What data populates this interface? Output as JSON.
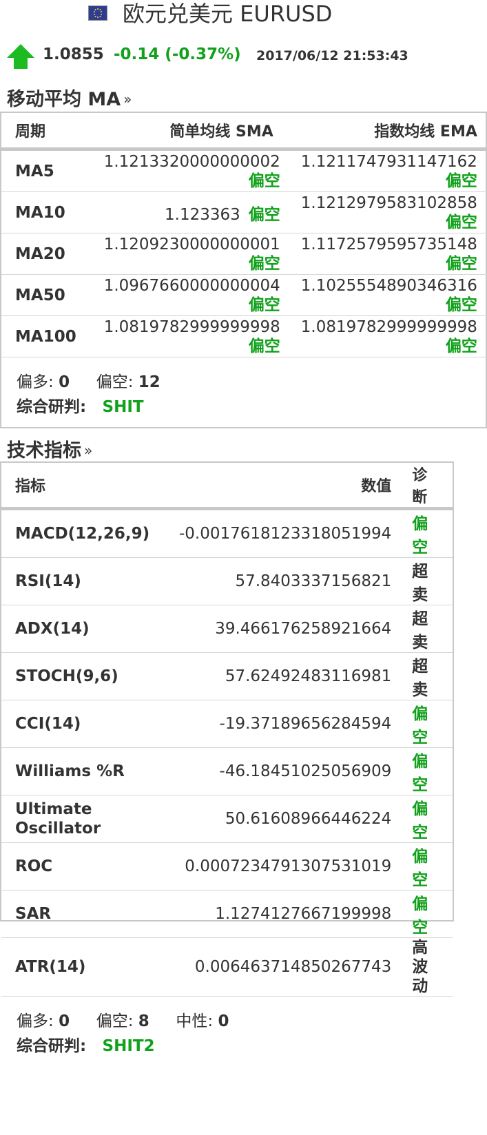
{
  "header": {
    "title": "欧元兑美元 EURUSD",
    "flag_icon": "eu-flag-icon",
    "trend_icon": "up-arrow-icon",
    "price": "1.0855",
    "change": "-0.14 (-0.37%)",
    "timestamp": "2017/06/12 21:53:43"
  },
  "colors": {
    "positive": "#11a11b",
    "text": "#333333",
    "border": "#c8c8c8"
  },
  "ma_section": {
    "title": "移动平均 MA",
    "link_icon": "double-chevron-right-icon",
    "columns": [
      "周期",
      "简单均线 SMA",
      "指数均线 EMA"
    ],
    "rows": [
      {
        "period": "MA5",
        "sma": "1.1213320000000002",
        "sma_signal": "偏空",
        "ema": "1.1211747931147162",
        "ema_signal": "偏空"
      },
      {
        "period": "MA10",
        "sma": "1.123363",
        "sma_signal": "偏空",
        "ema": "1.1212979583102858",
        "ema_signal": "偏空"
      },
      {
        "period": "MA20",
        "sma": "1.1209230000000001",
        "sma_signal": "偏空",
        "ema": "1.1172579595735148",
        "ema_signal": "偏空"
      },
      {
        "period": "MA50",
        "sma": "1.0967660000000004",
        "sma_signal": "偏空",
        "ema": "1.1025554890346316",
        "ema_signal": "偏空"
      },
      {
        "period": "MA100",
        "sma": "1.0819782999999998",
        "sma_signal": "偏空",
        "ema": "1.0819782999999998",
        "ema_signal": "偏空"
      }
    ],
    "summary": {
      "bull_label": "偏多:",
      "bull_count": "0",
      "bear_label": "偏空:",
      "bear_count": "12",
      "verdict_label": "综合研判:",
      "verdict": "SHIT"
    }
  },
  "indicator_section": {
    "title": "技术指标",
    "link_icon": "double-chevron-right-icon",
    "columns": [
      "指标",
      "数值",
      "诊断"
    ],
    "rows": [
      {
        "name": "MACD(12,26,9)",
        "value": "-0.0017618123318051994",
        "diag": "偏空",
        "diag_color": "#11a11b"
      },
      {
        "name": "RSI(14)",
        "value": "57.8403337156821",
        "diag": "超卖",
        "diag_color": "#333333"
      },
      {
        "name": "ADX(14)",
        "value": "39.466176258921664",
        "diag": "超卖",
        "diag_color": "#333333"
      },
      {
        "name": "STOCH(9,6)",
        "value": "57.62492483116981",
        "diag": "超卖",
        "diag_color": "#333333"
      },
      {
        "name": "CCI(14)",
        "value": "-19.37189656284594",
        "diag": "偏空",
        "diag_color": "#11a11b"
      },
      {
        "name": "Williams %R",
        "value": "-46.18451025056909",
        "diag": "偏空",
        "diag_color": "#11a11b"
      },
      {
        "name": "Ultimate Oscillator",
        "value": "50.61608966446224",
        "diag": "偏空",
        "diag_color": "#11a11b"
      },
      {
        "name": "ROC",
        "value": "0.0007234791307531019",
        "diag": "偏空",
        "diag_color": "#11a11b"
      },
      {
        "name": "SAR",
        "value": "1.1274127667199998",
        "diag": "偏空",
        "diag_color": "#11a11b"
      },
      {
        "name": "ATR(14)",
        "value": "0.006463714850267743",
        "diag": "高波动",
        "diag_color": "#333333"
      }
    ],
    "summary": {
      "bull_label": "偏多:",
      "bull_count": "0",
      "bear_label": "偏空:",
      "bear_count": "8",
      "neutral_label": "中性:",
      "neutral_count": "0",
      "verdict_label": "综合研判:",
      "verdict": "SHIT2"
    }
  }
}
